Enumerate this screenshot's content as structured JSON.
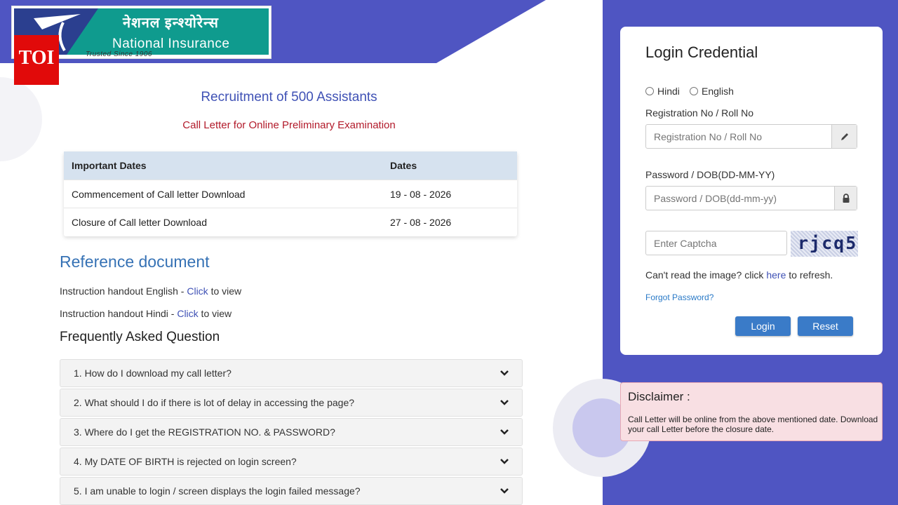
{
  "logo": {
    "hindi_text": "नेशनल इन्श्योरेन्स",
    "english_text": "National Insurance",
    "tagline": "Trusted Since 1906",
    "badge": "TOI"
  },
  "page": {
    "title": "Recruitment of 500 Assistants",
    "subtitle": "Call Letter for Online Preliminary Examination"
  },
  "dates_table": {
    "headers": [
      "Important Dates",
      "Dates"
    ],
    "rows": [
      {
        "label": "Commencement of Call letter Download",
        "date": "19 - 08 - 2026"
      },
      {
        "label": "Closure of Call letter Download",
        "date": "27 - 08 - 2026"
      }
    ]
  },
  "reference": {
    "title": "Reference document",
    "items": [
      {
        "prefix": "Instruction handout English - ",
        "link": "Click",
        "suffix": " to view"
      },
      {
        "prefix": "Instruction handout Hindi - ",
        "link": "Click",
        "suffix": " to view"
      }
    ]
  },
  "faq": {
    "title": "Frequently Asked Question",
    "items": [
      "1. How do I download my call letter?",
      "2. What should I do if there is lot of delay in accessing the page?",
      "3. Where do I get the REGISTRATION NO. & PASSWORD?",
      "4. My DATE OF BIRTH is rejected on login screen?",
      "5. I am unable to login / screen displays the login failed message?"
    ]
  },
  "login": {
    "title": "Login Credential",
    "lang_hindi": "Hindi",
    "lang_english": "English",
    "reg_label": "Registration No / Roll No",
    "reg_placeholder": "Registration No / Roll No",
    "pwd_label": "Password / DOB(DD-MM-YY)",
    "pwd_placeholder": "Password / DOB(dd-mm-yy)",
    "captcha_placeholder": "Enter Captcha",
    "captcha_text": "rjcq5",
    "refresh_prefix": "Can't read the image? click ",
    "refresh_link": "here",
    "refresh_suffix": " to refresh.",
    "forgot": "Forgot Password?",
    "login_button": "Login",
    "reset_button": "Reset"
  },
  "disclaimer": {
    "title": "Disclaimer :",
    "text": "Call Letter will be online from the above mentioned date. Download your call Letter before the closure date."
  },
  "colors": {
    "panel_blue": "#4f55c2",
    "title_blue": "#3f51b5",
    "subtitle_red": "#b21a2a",
    "button_blue": "#3a7bc8",
    "disclaimer_bg": "#f8dfe3"
  },
  "icons": {
    "reg_addon": "pencil-icon",
    "pwd_addon": "lock-icon",
    "faq_toggle": "chevron-down-icon"
  }
}
